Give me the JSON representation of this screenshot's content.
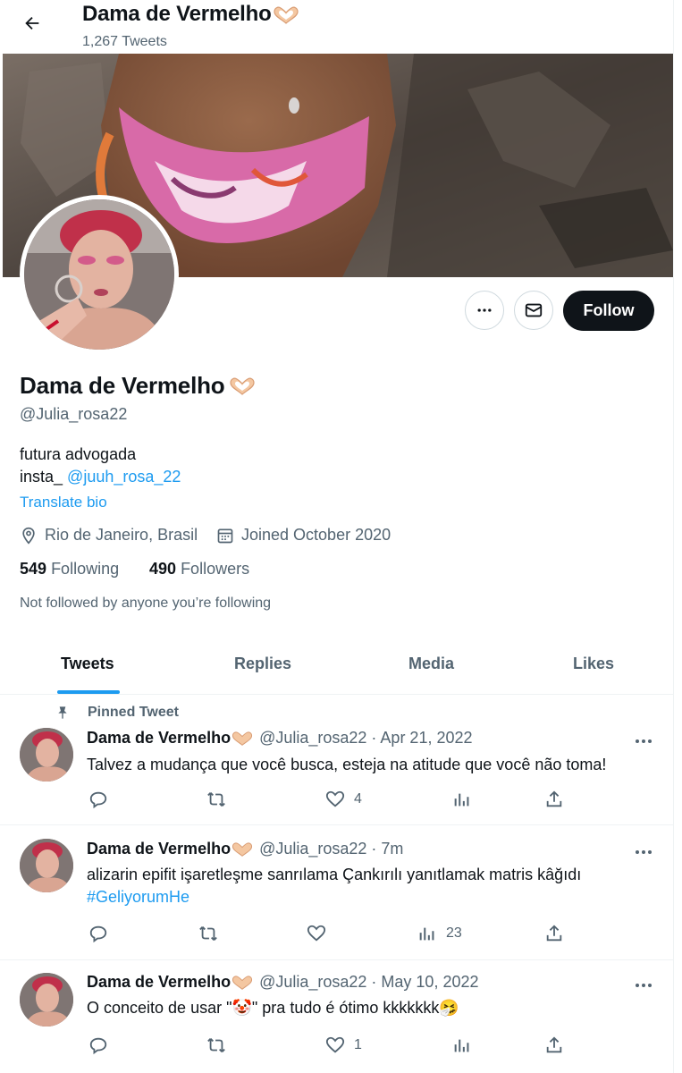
{
  "header": {
    "title": "Dama de Vermelho",
    "tweet_count": "1,267 Tweets"
  },
  "profile": {
    "name": "Dama de Vermelho",
    "handle": "@Julia_rosa22",
    "bio_line1": "futura advogada",
    "bio_line2_prefix": "insta_ ",
    "bio_line2_link": "@juuh_rosa_22",
    "translate": "Translate bio",
    "location": "Rio de Janeiro, Brasil",
    "joined": "Joined October 2020",
    "following_count": "549",
    "following_label": "Following",
    "followers_count": "490",
    "followers_label": "Followers",
    "not_followed": "Not followed by anyone you’re following",
    "follow_label": "Follow"
  },
  "tabs": [
    {
      "label": "Tweets",
      "active": true
    },
    {
      "label": "Replies",
      "active": false
    },
    {
      "label": "Media",
      "active": false
    },
    {
      "label": "Likes",
      "active": false
    }
  ],
  "pinned_label": "Pinned Tweet",
  "tweets": [
    {
      "name": "Dama de Vermelho",
      "sub": "@Julia_rosa22 · Apr 21, 2022",
      "text": "Talvez a mudança que você busca, esteja na atitude que você não toma!",
      "likes": "4",
      "views": ""
    },
    {
      "name": "Dama de Vermelho",
      "sub": "@Julia_rosa22 · 7m",
      "text": "alizarin epifit işaretleşme sanrılama Çankırılı yanıtlamak matris kâğıdı",
      "hashtag": "#GeliyorumHe",
      "likes": "",
      "views": "23"
    },
    {
      "name": "Dama de Vermelho",
      "sub": "@Julia_rosa22 · May 10, 2022",
      "text_pre": "O conceito de usar \"",
      "text_emoji": "🤡",
      "text_post": "\" pra tudo é ótimo kkkkkkk",
      "text_end_emoji": "🤧",
      "likes": "1",
      "views": ""
    }
  ],
  "icons": {
    "back": "arrow-left-icon",
    "more": "more-dots-icon",
    "message": "envelope-icon",
    "location": "location-pin-icon",
    "calendar": "calendar-icon",
    "pin": "pin-icon",
    "reply": "reply-icon",
    "retweet": "retweet-icon",
    "like": "heart-icon",
    "views": "views-chart-icon",
    "share": "share-icon",
    "name_emoji": "heart-hands-emoji"
  },
  "colors": {
    "accent": "#1d9bf0",
    "text": "#0f1419",
    "muted": "#536471",
    "border": "#eff3f4"
  }
}
